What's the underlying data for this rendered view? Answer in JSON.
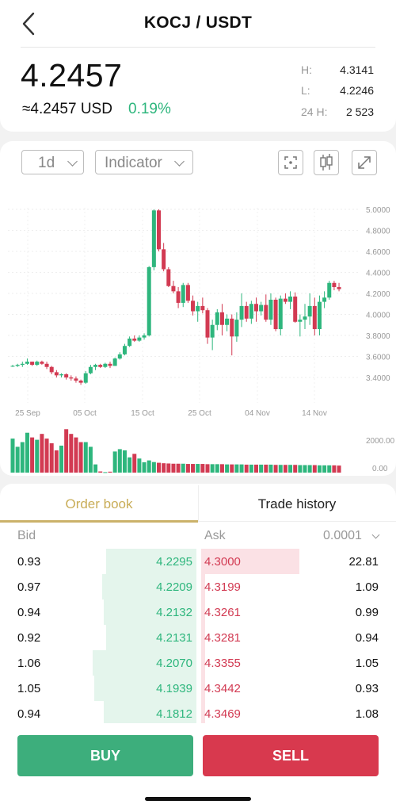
{
  "header": {
    "pair": "KOCJ / USDT"
  },
  "ticker": {
    "price": "4.2457",
    "usd": "≈4.2457 USD",
    "change": "0.19%",
    "stats": [
      {
        "label": "H:",
        "value": "4.3141"
      },
      {
        "label": "L:",
        "value": "4.2246"
      },
      {
        "label": "24 H:",
        "value": "2 523"
      }
    ]
  },
  "toolbar": {
    "interval": "1d",
    "indicator": "Indicator"
  },
  "colors": {
    "up": "#2eb67d",
    "down": "#d23a52",
    "accent": "#c9ad58"
  },
  "icons": [
    "chevron-left-icon",
    "chevron-down-icon",
    "focus-icon",
    "candlestick-icon",
    "expand-icon"
  ],
  "chart_data": {
    "type": "candlestick",
    "price_ticks": [
      "5.0000",
      "4.8000",
      "4.6000",
      "4.4000",
      "4.2000",
      "4.0000",
      "3.8000",
      "3.6000",
      "3.4000"
    ],
    "date_ticks": [
      "25 Sep",
      "05 Oct",
      "15 Oct",
      "25 Oct",
      "04 Nov",
      "14 Nov"
    ],
    "volume_ticks": [
      "2000.00",
      "0.00"
    ],
    "ylim": [
      3.3,
      5.05
    ],
    "volume_max": 2400,
    "candles": [
      [
        3.51,
        3.52,
        3.5,
        3.51
      ],
      [
        3.51,
        3.53,
        3.5,
        3.52
      ],
      [
        3.52,
        3.55,
        3.5,
        3.53
      ],
      [
        3.53,
        3.58,
        3.52,
        3.55
      ],
      [
        3.55,
        3.55,
        3.51,
        3.52
      ],
      [
        3.52,
        3.56,
        3.51,
        3.55
      ],
      [
        3.55,
        3.56,
        3.52,
        3.53
      ],
      [
        3.53,
        3.55,
        3.48,
        3.5
      ],
      [
        3.5,
        3.51,
        3.43,
        3.45
      ],
      [
        3.45,
        3.47,
        3.4,
        3.42
      ],
      [
        3.42,
        3.44,
        3.4,
        3.43
      ],
      [
        3.43,
        3.44,
        3.38,
        3.4
      ],
      [
        3.4,
        3.42,
        3.37,
        3.39
      ],
      [
        3.39,
        3.41,
        3.35,
        3.37
      ],
      [
        3.37,
        3.38,
        3.33,
        3.35
      ],
      [
        3.35,
        3.46,
        3.34,
        3.44
      ],
      [
        3.44,
        3.52,
        3.43,
        3.5
      ],
      [
        3.5,
        3.53,
        3.47,
        3.52
      ],
      [
        3.52,
        3.53,
        3.49,
        3.5
      ],
      [
        3.5,
        3.54,
        3.49,
        3.53
      ],
      [
        3.53,
        3.55,
        3.49,
        3.51
      ],
      [
        3.51,
        3.59,
        3.51,
        3.58
      ],
      [
        3.58,
        3.64,
        3.57,
        3.62
      ],
      [
        3.62,
        3.72,
        3.61,
        3.7
      ],
      [
        3.7,
        3.79,
        3.69,
        3.77
      ],
      [
        3.77,
        3.8,
        3.74,
        3.75
      ],
      [
        3.75,
        3.8,
        3.74,
        3.78
      ],
      [
        3.78,
        3.82,
        3.76,
        3.8
      ],
      [
        3.8,
        4.46,
        3.79,
        4.45
      ],
      [
        4.45,
        5.0,
        4.42,
        4.99
      ],
      [
        4.99,
        5.0,
        4.6,
        4.62
      ],
      [
        4.62,
        4.68,
        4.41,
        4.43
      ],
      [
        4.43,
        4.45,
        4.26,
        4.27
      ],
      [
        4.27,
        4.32,
        4.2,
        4.22
      ],
      [
        4.22,
        4.26,
        4.06,
        4.11
      ],
      [
        4.11,
        4.3,
        4.07,
        4.28
      ],
      [
        4.28,
        4.3,
        4.11,
        4.13
      ],
      [
        4.13,
        4.18,
        3.99,
        4.03
      ],
      [
        4.03,
        4.12,
        3.93,
        4.08
      ],
      [
        4.08,
        4.16,
        4.01,
        4.04
      ],
      [
        4.04,
        4.06,
        3.72,
        3.78
      ],
      [
        3.78,
        3.95,
        3.66,
        3.9
      ],
      [
        3.9,
        4.05,
        3.85,
        4.02
      ],
      [
        4.02,
        4.1,
        3.8,
        3.9
      ],
      [
        3.9,
        4.0,
        3.84,
        3.96
      ],
      [
        3.96,
        4.0,
        3.61,
        3.79
      ],
      [
        3.79,
        4.02,
        3.74,
        3.95
      ],
      [
        3.95,
        4.2,
        3.88,
        4.08
      ],
      [
        4.08,
        4.12,
        3.93,
        3.96
      ],
      [
        3.96,
        4.13,
        3.91,
        4.1
      ],
      [
        4.1,
        4.16,
        3.93,
        4.03
      ],
      [
        4.03,
        4.12,
        3.99,
        4.09
      ],
      [
        4.09,
        4.19,
        3.93,
        3.95
      ],
      [
        3.95,
        4.2,
        3.9,
        4.14
      ],
      [
        4.14,
        4.16,
        3.84,
        3.86
      ],
      [
        3.86,
        4.18,
        3.8,
        4.15
      ],
      [
        4.15,
        4.2,
        4.1,
        4.12
      ],
      [
        4.12,
        4.22,
        4.05,
        4.17
      ],
      [
        4.17,
        4.21,
        3.92,
        3.93
      ],
      [
        3.93,
        4.0,
        3.79,
        3.95
      ],
      [
        3.95,
        4.1,
        3.86,
        3.98
      ],
      [
        3.98,
        4.2,
        3.9,
        4.08
      ],
      [
        4.08,
        4.16,
        3.8,
        3.86
      ],
      [
        3.86,
        4.18,
        3.8,
        4.12
      ],
      [
        4.12,
        4.22,
        4.06,
        4.16
      ],
      [
        4.16,
        4.32,
        4.14,
        4.3
      ],
      [
        4.3,
        4.32,
        4.23,
        4.26
      ],
      [
        4.26,
        4.3,
        4.22,
        4.24
      ]
    ],
    "volumes": [
      1450,
      1100,
      1300,
      1700,
      1500,
      1400,
      1650,
      1450,
      1250,
      950,
      1150,
      1850,
      1650,
      1500,
      1300,
      1300,
      1100,
      350,
      50,
      20,
      40,
      900,
      1000,
      950,
      650,
      800,
      600,
      440,
      520,
      450,
      420,
      400,
      390,
      380,
      380,
      380,
      370,
      370,
      370,
      370,
      360,
      360,
      360,
      360,
      350,
      350,
      350,
      350,
      340,
      340,
      340,
      340,
      340,
      340,
      330,
      330,
      330,
      330,
      330,
      320,
      320,
      320,
      320,
      310,
      310,
      310,
      310,
      300
    ]
  },
  "orderbook": {
    "tabs": [
      "Order book",
      "Trade history"
    ],
    "bid_label": "Bid",
    "ask_label": "Ask",
    "precision": "0.0001",
    "rows": [
      {
        "bid_qty": "0.93",
        "bid_price": "4.2295",
        "ask_price": "4.3000",
        "ask_qty": "22.81",
        "bid_depth": 0.46,
        "ask_depth": 0.5
      },
      {
        "bid_qty": "0.97",
        "bid_price": "4.2209",
        "ask_price": "4.3199",
        "ask_qty": "1.09",
        "bid_depth": 0.48,
        "ask_depth": 0.02
      },
      {
        "bid_qty": "0.94",
        "bid_price": "4.2132",
        "ask_price": "4.3261",
        "ask_qty": "0.99",
        "bid_depth": 0.47,
        "ask_depth": 0.02
      },
      {
        "bid_qty": "0.92",
        "bid_price": "4.2131",
        "ask_price": "4.3281",
        "ask_qty": "0.94",
        "bid_depth": 0.46,
        "ask_depth": 0.02
      },
      {
        "bid_qty": "1.06",
        "bid_price": "4.2070",
        "ask_price": "4.3355",
        "ask_qty": "1.05",
        "bid_depth": 0.53,
        "ask_depth": 0.02
      },
      {
        "bid_qty": "1.05",
        "bid_price": "4.1939",
        "ask_price": "4.3442",
        "ask_qty": "0.93",
        "bid_depth": 0.52,
        "ask_depth": 0.02
      },
      {
        "bid_qty": "0.94",
        "bid_price": "4.1812",
        "ask_price": "4.3469",
        "ask_qty": "1.08",
        "bid_depth": 0.47,
        "ask_depth": 0.02
      }
    ]
  },
  "actions": {
    "buy": "BUY",
    "sell": "SELL"
  }
}
